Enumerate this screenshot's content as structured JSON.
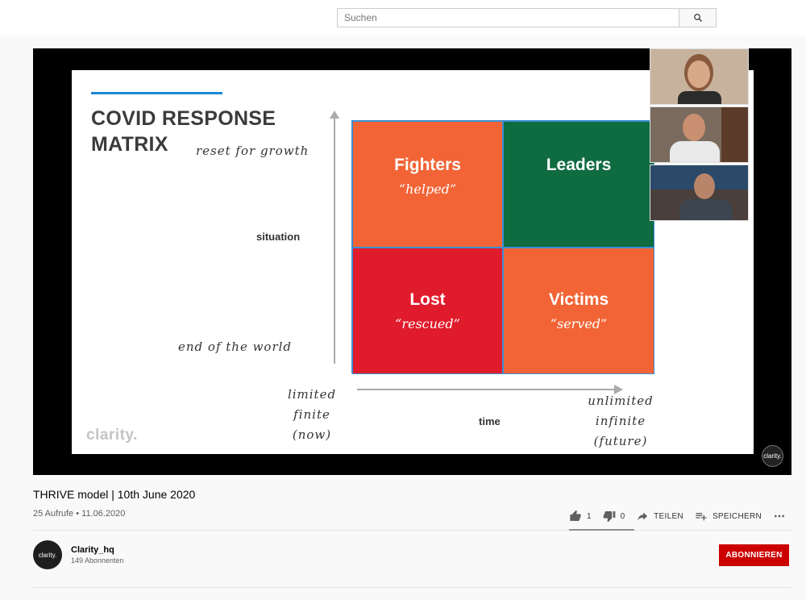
{
  "search": {
    "placeholder": "Suchen"
  },
  "slide": {
    "title_line1": "COVID RESPONSE",
    "title_line2": "MATRIX",
    "y_top_note": "reset for growth",
    "y_bottom_note": "end of the world",
    "y_axis_label": "situation",
    "x_axis_label": "time",
    "x_left_note": [
      "limited",
      "finite",
      "(now)"
    ],
    "x_right_note": [
      "unlimited",
      "infinite",
      "(future)"
    ],
    "quadrants": [
      {
        "title": "Fighters",
        "subtitle": "“helped”",
        "color": "#f26436"
      },
      {
        "title": "Leaders",
        "subtitle": "",
        "color": "#0f6b40"
      },
      {
        "title": "Lost",
        "subtitle": "“rescued”",
        "color": "#e01b2c"
      },
      {
        "title": "Victims",
        "subtitle": "“served”",
        "color": "#f26436"
      }
    ],
    "logo_text": "clarity."
  },
  "player": {
    "badge_text": "clarity."
  },
  "video": {
    "title": "THRIVE model | 10th June 2020",
    "views": "25 Aufrufe",
    "date": "11.06.2020",
    "likes": "1",
    "dislikes": "0",
    "share_label": "TEILEN",
    "save_label": "SPEICHERN"
  },
  "channel": {
    "avatar_text": "clarity.",
    "name": "Clarity_hq",
    "subscribers": "149 Abonnenten",
    "subscribe_label": "ABONNIEREN"
  },
  "colors": {
    "accent_red": "#cc0000",
    "rule_blue": "#1c86d6"
  }
}
